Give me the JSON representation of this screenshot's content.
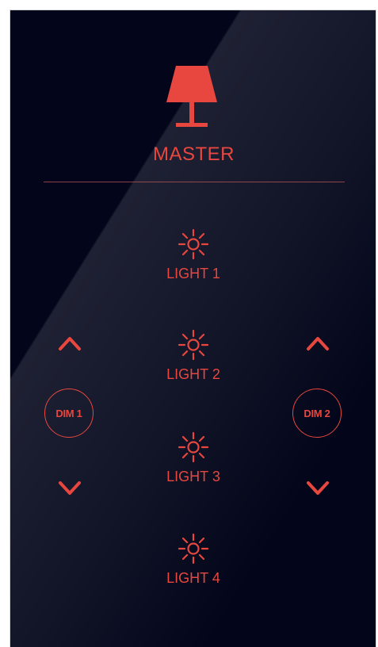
{
  "master": {
    "label": "MASTER"
  },
  "lights": [
    {
      "label": "LIGHT 1"
    },
    {
      "label": "LIGHT 2"
    },
    {
      "label": "LIGHT 3"
    },
    {
      "label": "LIGHT 4"
    }
  ],
  "dim_left": {
    "label": "DIM 1"
  },
  "dim_right": {
    "label": "DIM 2"
  },
  "icons": {
    "master": "lamp-icon",
    "light": "sun-icon",
    "up": "chevron-up-icon",
    "down": "chevron-down-icon"
  },
  "colors": {
    "accent": "#e8473f",
    "panel": "#03061a"
  }
}
